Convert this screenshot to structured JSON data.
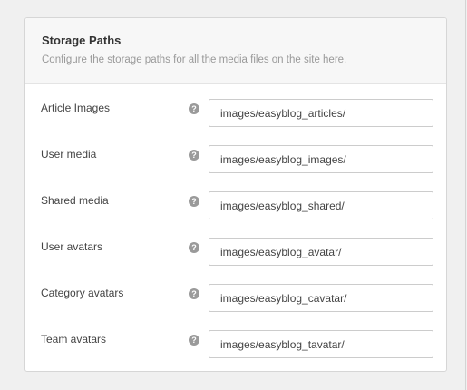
{
  "panel": {
    "title": "Storage Paths",
    "description": "Configure the storage paths for all the media files on the site here."
  },
  "help_glyph": "?",
  "rows": [
    {
      "label": "Article Images",
      "value": "images/easyblog_articles/"
    },
    {
      "label": "User media",
      "value": "images/easyblog_images/"
    },
    {
      "label": "Shared media",
      "value": "images/easyblog_shared/"
    },
    {
      "label": "User avatars",
      "value": "images/easyblog_avatar/"
    },
    {
      "label": "Category avatars",
      "value": "images/easyblog_cavatar/"
    },
    {
      "label": "Team avatars",
      "value": "images/easyblog_tavatar/"
    }
  ]
}
